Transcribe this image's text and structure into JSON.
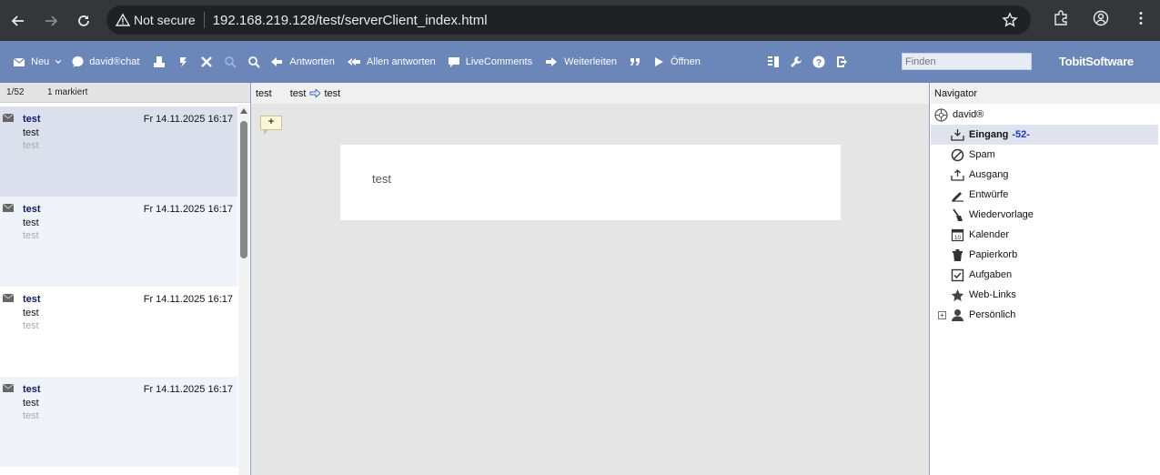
{
  "browser": {
    "security": "Not secure",
    "url": "192.168.219.128/test/serverClient_index.html"
  },
  "toolbar": {
    "new": "Neu",
    "chat": "david®chat",
    "reply": "Antworten",
    "reply_all": "Allen antworten",
    "livecomments": "LiveComments",
    "forward": "Weiterleiten",
    "open": "Öffnen",
    "find_placeholder": "Finden",
    "brand": "TobitSoftware"
  },
  "list": {
    "count": "1/52",
    "marked": "1 markiert",
    "messages": [
      {
        "sender": "test",
        "date": "Fr 14.11.2025 16:17",
        "subject": "test",
        "preview": "test"
      },
      {
        "sender": "test",
        "date": "Fr 14.11.2025 16:17",
        "subject": "test",
        "preview": "test"
      },
      {
        "sender": "test",
        "date": "Fr 14.11.2025 16:17",
        "subject": "test",
        "preview": "test"
      },
      {
        "sender": "test",
        "date": "Fr 14.11.2025 16:17",
        "subject": "test",
        "preview": "test"
      }
    ]
  },
  "reader": {
    "from": "test",
    "to_a": "test",
    "to_b": "test",
    "note_label": "+",
    "body": "test"
  },
  "navigator": {
    "title": "Navigator",
    "root": "david®",
    "items": [
      {
        "label": "Eingang",
        "badge": "-52-"
      },
      {
        "label": "Spam"
      },
      {
        "label": "Ausgang"
      },
      {
        "label": "Entwürfe"
      },
      {
        "label": "Wiedervorlage"
      },
      {
        "label": "Kalender"
      },
      {
        "label": "Papierkorb"
      },
      {
        "label": "Aufgaben"
      },
      {
        "label": "Web-Links"
      },
      {
        "label": "Persönlich"
      }
    ]
  }
}
